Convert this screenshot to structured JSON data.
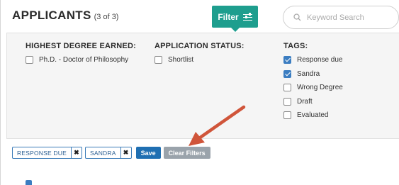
{
  "header": {
    "title": "APPLICANTS",
    "count": "(3 of 3)",
    "filter_label": "Filter",
    "search_placeholder": "Keyword Search"
  },
  "filters": {
    "degree": {
      "heading": "HIGHEST DEGREE EARNED:",
      "options": [
        {
          "label": "Ph.D. - Doctor of Philosophy",
          "checked": false
        }
      ]
    },
    "status": {
      "heading": "APPLICATION STATUS:",
      "options": [
        {
          "label": "Shortlist",
          "checked": false
        }
      ]
    },
    "tags": {
      "heading": "TAGS:",
      "options": [
        {
          "label": "Response due",
          "checked": true
        },
        {
          "label": "Sandra",
          "checked": true
        },
        {
          "label": "Wrong Degree",
          "checked": false
        },
        {
          "label": "Draft",
          "checked": false
        },
        {
          "label": "Evaluated",
          "checked": false
        }
      ]
    }
  },
  "active_filters": {
    "chips": [
      {
        "label": "RESPONSE DUE",
        "remove": "✖"
      },
      {
        "label": "SANDRA",
        "remove": "✖"
      }
    ],
    "save_label": "Save",
    "clear_label": "Clear Filters"
  },
  "colors": {
    "accent": "#1e9e8e",
    "checkbox": "#3b7dc1",
    "save": "#1f6fb2",
    "clear": "#9aa3ab",
    "annotation_arrow": "#d0553a"
  }
}
